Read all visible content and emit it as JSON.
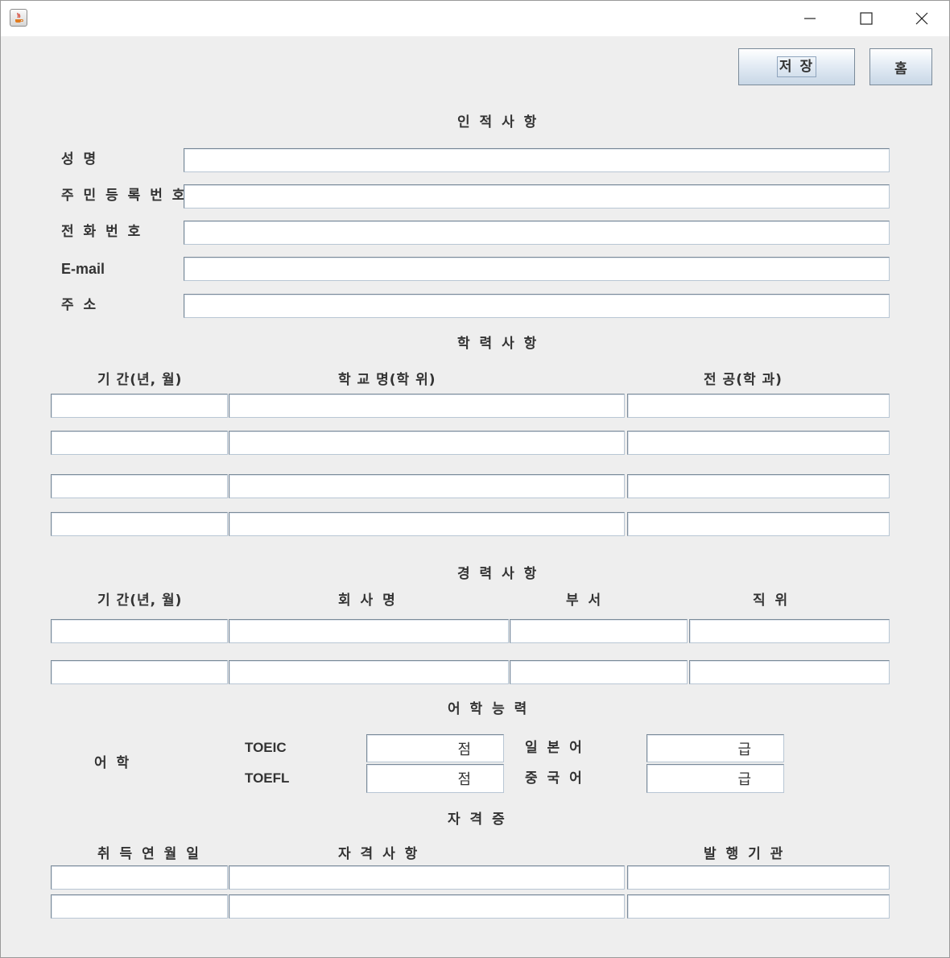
{
  "window": {
    "title": "",
    "controls": {
      "minimize": "minimize-icon",
      "maximize": "maximize-icon",
      "close": "close-icon"
    }
  },
  "toolbar": {
    "save_label": "저 장",
    "home_label": "홈"
  },
  "personal": {
    "heading": "인 적 사 항",
    "fields": [
      {
        "label": "성 명",
        "value": ""
      },
      {
        "label": "주 민 등 록 번 호",
        "value": ""
      },
      {
        "label": "전 화 번 호",
        "value": ""
      },
      {
        "label": "E-mail",
        "value": ""
      },
      {
        "label": "주 소",
        "value": ""
      }
    ]
  },
  "education": {
    "heading": "학 력 사 항",
    "columns": [
      "기 간(년, 월)",
      "학 교 명(학 위)",
      "전 공(학 과)"
    ],
    "rows": [
      [
        "",
        "",
        ""
      ],
      [
        "",
        "",
        ""
      ],
      [
        "",
        "",
        ""
      ],
      [
        "",
        "",
        ""
      ]
    ]
  },
  "career": {
    "heading": "경 력 사 항",
    "columns": [
      "기 간(년, 월)",
      "회 사 명",
      "부 서",
      "직 위"
    ],
    "rows": [
      [
        "",
        "",
        "",
        ""
      ],
      [
        "",
        "",
        "",
        ""
      ]
    ]
  },
  "language": {
    "heading": "어 학 능 력",
    "group_label": "어 학",
    "toeic_label": "TOEIC",
    "toeic_value": "점",
    "toefl_label": "TOEFL",
    "toefl_value": "점",
    "japanese_label": "일 본 어",
    "japanese_value": "급",
    "chinese_label": "중 국 어",
    "chinese_value": "급"
  },
  "certificates": {
    "heading": "자 격 증",
    "columns": [
      "취 득 연 월 일",
      "자 격 사 항",
      "발 행 기 관"
    ],
    "rows": [
      [
        "",
        "",
        ""
      ],
      [
        "",
        "",
        ""
      ]
    ]
  }
}
